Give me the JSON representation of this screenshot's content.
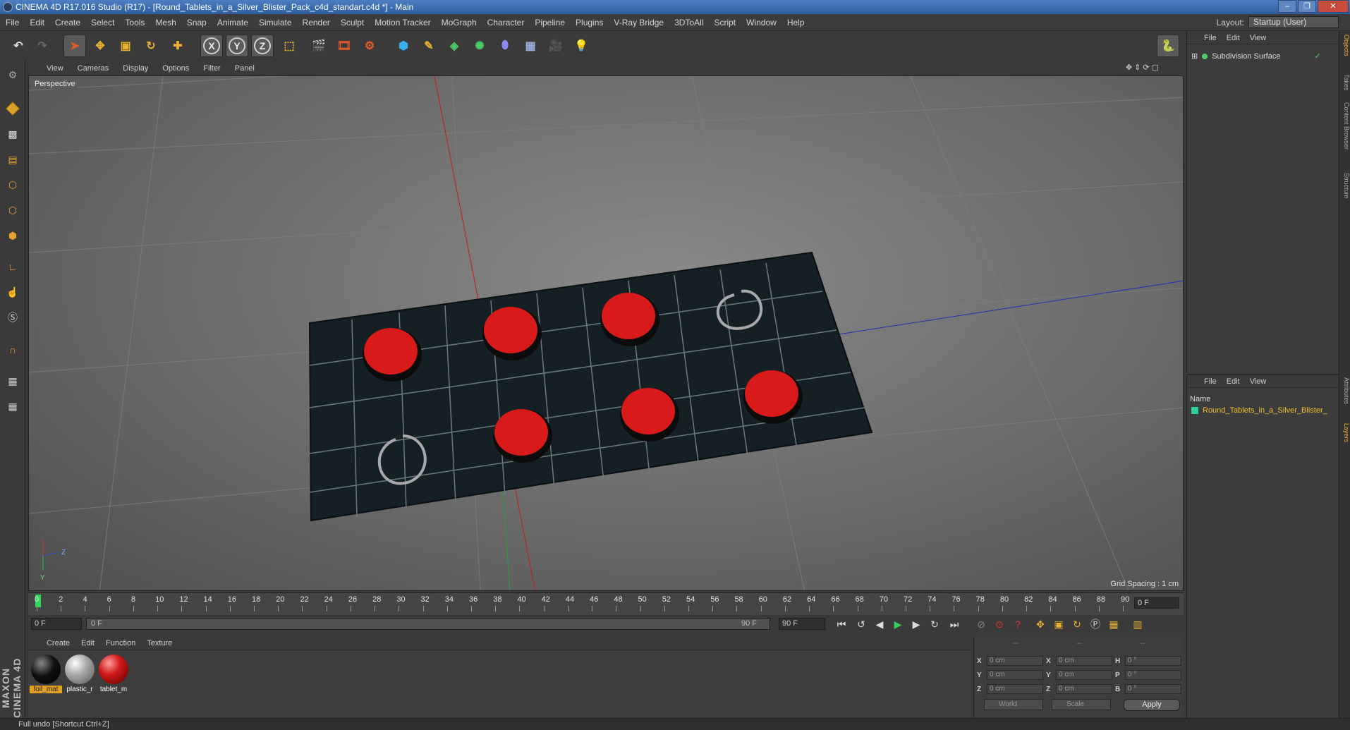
{
  "window": {
    "title": "CINEMA 4D R17.016 Studio (R17) - [Round_Tablets_in_a_Silver_Blister_Pack_c4d_standart.c4d *] - Main"
  },
  "menu": [
    "File",
    "Edit",
    "Create",
    "Select",
    "Tools",
    "Mesh",
    "Snap",
    "Animate",
    "Simulate",
    "Render",
    "Sculpt",
    "Motion Tracker",
    "MoGraph",
    "Character",
    "Pipeline",
    "Plugins",
    "V-Ray Bridge",
    "3DToAll",
    "Script",
    "Window",
    "Help"
  ],
  "layout": {
    "label": "Layout:",
    "value": "Startup (User)"
  },
  "viewport": {
    "menu": [
      "View",
      "Cameras",
      "Display",
      "Options",
      "Filter",
      "Panel"
    ],
    "label": "Perspective",
    "grid_spacing": "Grid Spacing : 1 cm",
    "axis_x": "Z",
    "axis_y": "Y"
  },
  "timeline": {
    "ticks": [
      "0",
      "2",
      "4",
      "6",
      "8",
      "10",
      "12",
      "14",
      "16",
      "18",
      "20",
      "22",
      "24",
      "26",
      "28",
      "30",
      "32",
      "34",
      "36",
      "38",
      "40",
      "42",
      "44",
      "46",
      "48",
      "50",
      "52",
      "54",
      "56",
      "58",
      "60",
      "62",
      "64",
      "66",
      "68",
      "70",
      "72",
      "74",
      "76",
      "78",
      "80",
      "82",
      "84",
      "86",
      "88",
      "90"
    ],
    "current_frame": "0 F"
  },
  "transport": {
    "start": "0 F",
    "range_start": "0 F",
    "range_end": "90 F",
    "end": "90 F"
  },
  "materials": {
    "menu": [
      "Create",
      "Edit",
      "Function",
      "Texture"
    ],
    "items": [
      {
        "name": "foil_mat",
        "color": "#111111"
      },
      {
        "name": "plastic_r",
        "color": "#9a9a9a"
      },
      {
        "name": "tablet_m",
        "color": "#c81818"
      }
    ]
  },
  "coordinates": {
    "rows": [
      {
        "a": "X",
        "av": "0 cm",
        "b": "X",
        "bv": "0 cm",
        "c": "H",
        "cv": "0 °"
      },
      {
        "a": "Y",
        "av": "0 cm",
        "b": "Y",
        "bv": "0 cm",
        "c": "P",
        "cv": "0 °"
      },
      {
        "a": "Z",
        "av": "0 cm",
        "b": "Z",
        "bv": "0 cm",
        "c": "B",
        "cv": "0 °"
      }
    ],
    "world": "World",
    "scale": "Scale",
    "apply": "Apply",
    "dashes": [
      "--",
      "--",
      "--"
    ]
  },
  "objects": {
    "menu": [
      "File",
      "Edit",
      "View"
    ],
    "item": "Subdivision Surface"
  },
  "layers": {
    "menu": [
      "File",
      "Edit",
      "View"
    ],
    "header": "Name",
    "item": "Round_Tablets_in_a_Silver_Blister_"
  },
  "sidetabs": [
    "Objects",
    "Takes",
    "Content Browser",
    "Structure",
    "Attributes",
    "Layers"
  ],
  "status": "Full undo [Shortcut Ctrl+Z]",
  "logo": "MAXON CINEMA 4D"
}
